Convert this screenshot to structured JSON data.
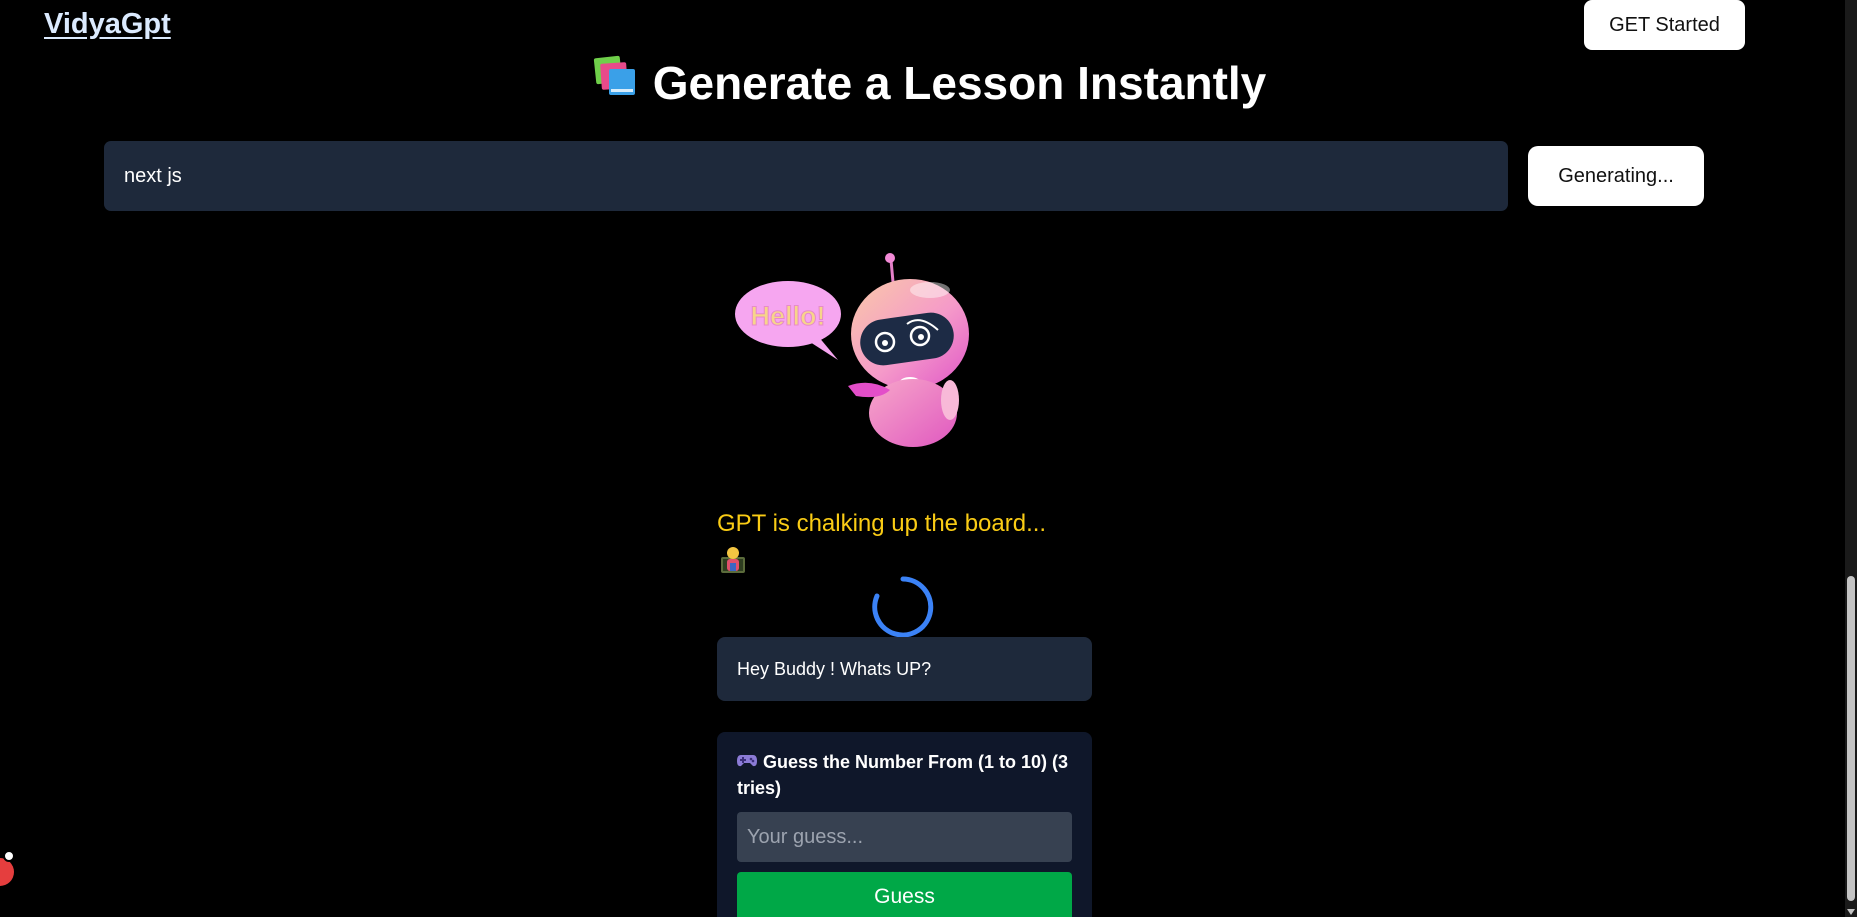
{
  "header": {
    "brand": "VidyaGpt",
    "cta_label": "GET Started"
  },
  "hero": {
    "title": "Generate a Lesson Instantly",
    "title_icon": "books-icon"
  },
  "generator": {
    "topic_value": "next js",
    "button_label": "Generating..."
  },
  "mascot": {
    "speech_bubble_text": "Hello!",
    "icon": "robot-mascot"
  },
  "loading": {
    "status_text": "GPT is chalking up the board...",
    "status_icon": "teacher-icon",
    "spinner_icon": "spinner-icon"
  },
  "chat": {
    "message": "Hey Buddy ! Whats UP?"
  },
  "game": {
    "icon": "game-controller-icon",
    "title": "Guess the Number From (1 to 10) (3 tries)",
    "input_placeholder": "Your guess...",
    "button_label": "Guess"
  },
  "colors": {
    "background": "#000000",
    "panel": "#1e293b",
    "card": "#0f172a",
    "status_yellow": "#facc15",
    "guess_green": "#00a847",
    "spinner_blue": "#3b82f6",
    "mascot_pink": "#f472b6"
  }
}
